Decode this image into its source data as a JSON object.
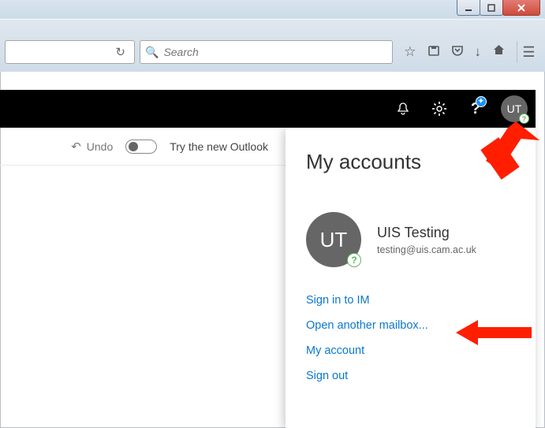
{
  "window": {
    "minimize_label": "Minimize",
    "maximize_label": "Maximize",
    "close_label": "Close"
  },
  "browser": {
    "reload_label": "Reload",
    "search_placeholder": "Search",
    "icons": {
      "bookmark": "bookmark",
      "library": "library",
      "pocket": "pocket",
      "downloads": "downloads",
      "home": "home",
      "menu": "menu"
    }
  },
  "app_header": {
    "notifications": "Notifications",
    "settings": "Settings",
    "help": "Help",
    "avatar_initials": "UT"
  },
  "left_bar": {
    "undo_label": "Undo",
    "try_label": "Try the new Outlook",
    "toggle_on": false
  },
  "flyout": {
    "title": "My accounts",
    "close_label": "Close",
    "avatar_initials": "UT",
    "user_name": "UIS Testing",
    "user_email": "testing@uis.cam.ac.uk",
    "links": [
      "Sign in to IM",
      "Open another mailbox...",
      "My account",
      "Sign out"
    ]
  },
  "colors": {
    "link": "#0a78d1",
    "avatar_bg": "#666666",
    "accent_badge": "#1890ff",
    "arrow": "#ff1e00"
  }
}
